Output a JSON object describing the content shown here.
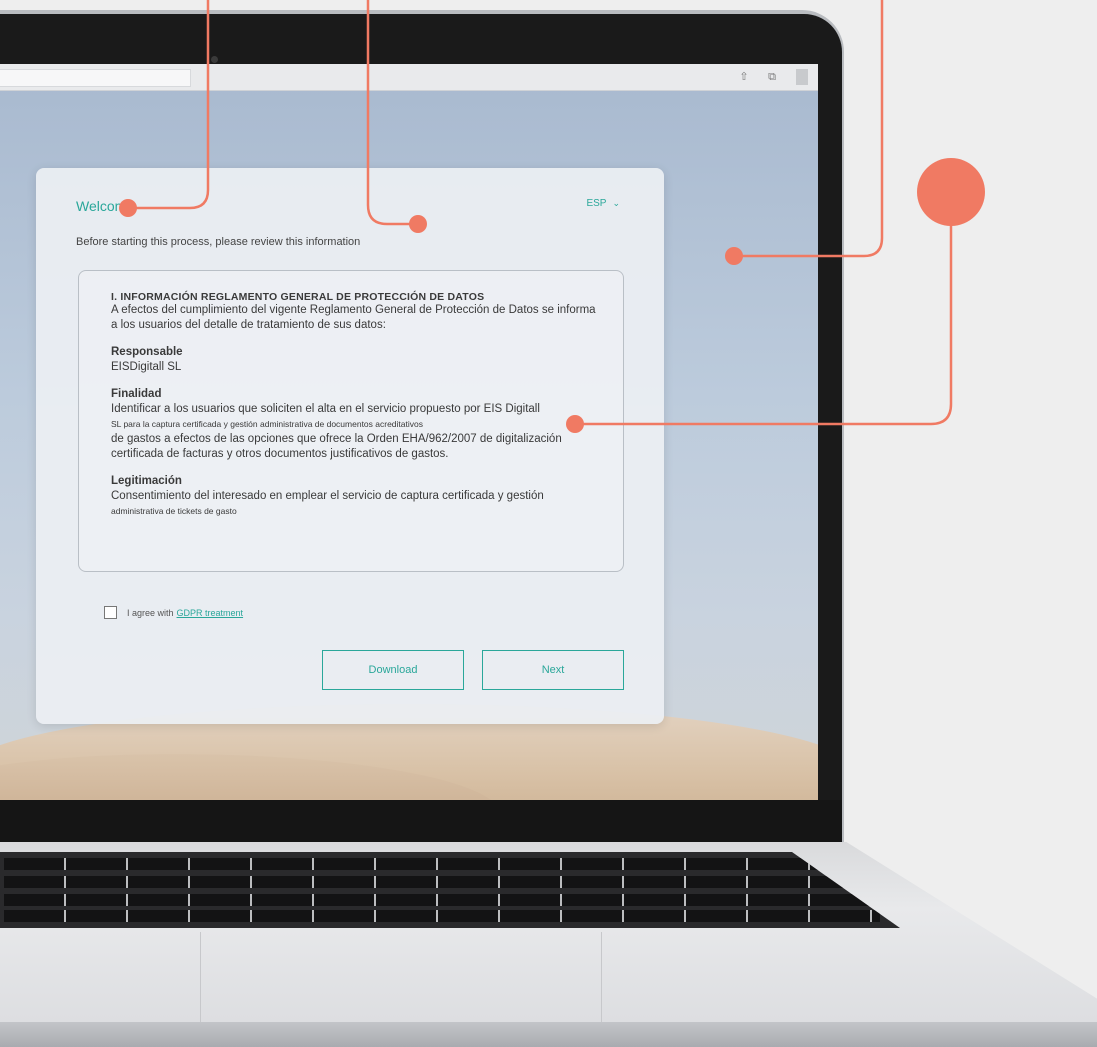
{
  "dialog": {
    "welcome_title": "Welcome",
    "language": "ESP",
    "subtitle": "Before starting this process, please review this information",
    "section_title": "I. INFORMACIÓN REGLAMENTO GENERAL DE PROTECCIÓN DE DATOS",
    "intro": "A efectos del cumplimiento del vigente Reglamento General de Protección de Datos se informa a los usuarios del detalle de tratamiento de sus datos:",
    "responsable_heading": "Responsable",
    "responsable_value": "EISDigitall SL",
    "finalidad_heading": "Finalidad",
    "finalidad_line1": "Identificar a los usuarios que soliciten el alta en el servicio propuesto por EIS Digitall",
    "finalidad_line2": "SL para la captura certificada y gestión administrativa de documentos acreditativos",
    "finalidad_line3": "de gastos a efectos de las opciones que ofrece la Orden EHA/962/2007 de digitalización certificada de facturas y otros documentos justificativos de gastos.",
    "legitimacion_heading": "Legitimación",
    "legitimacion_line1": "Consentimiento del interesado en emplear el servicio de captura certificada y gestión",
    "legitimacion_line2": "administrativa de tickets de gasto",
    "agree_text": "I agree with",
    "agree_link": "GDPR treatment",
    "download_label": "Download",
    "next_label": "Next"
  },
  "colors": {
    "accent": "#2aa79a",
    "callout": "#f07a63"
  }
}
